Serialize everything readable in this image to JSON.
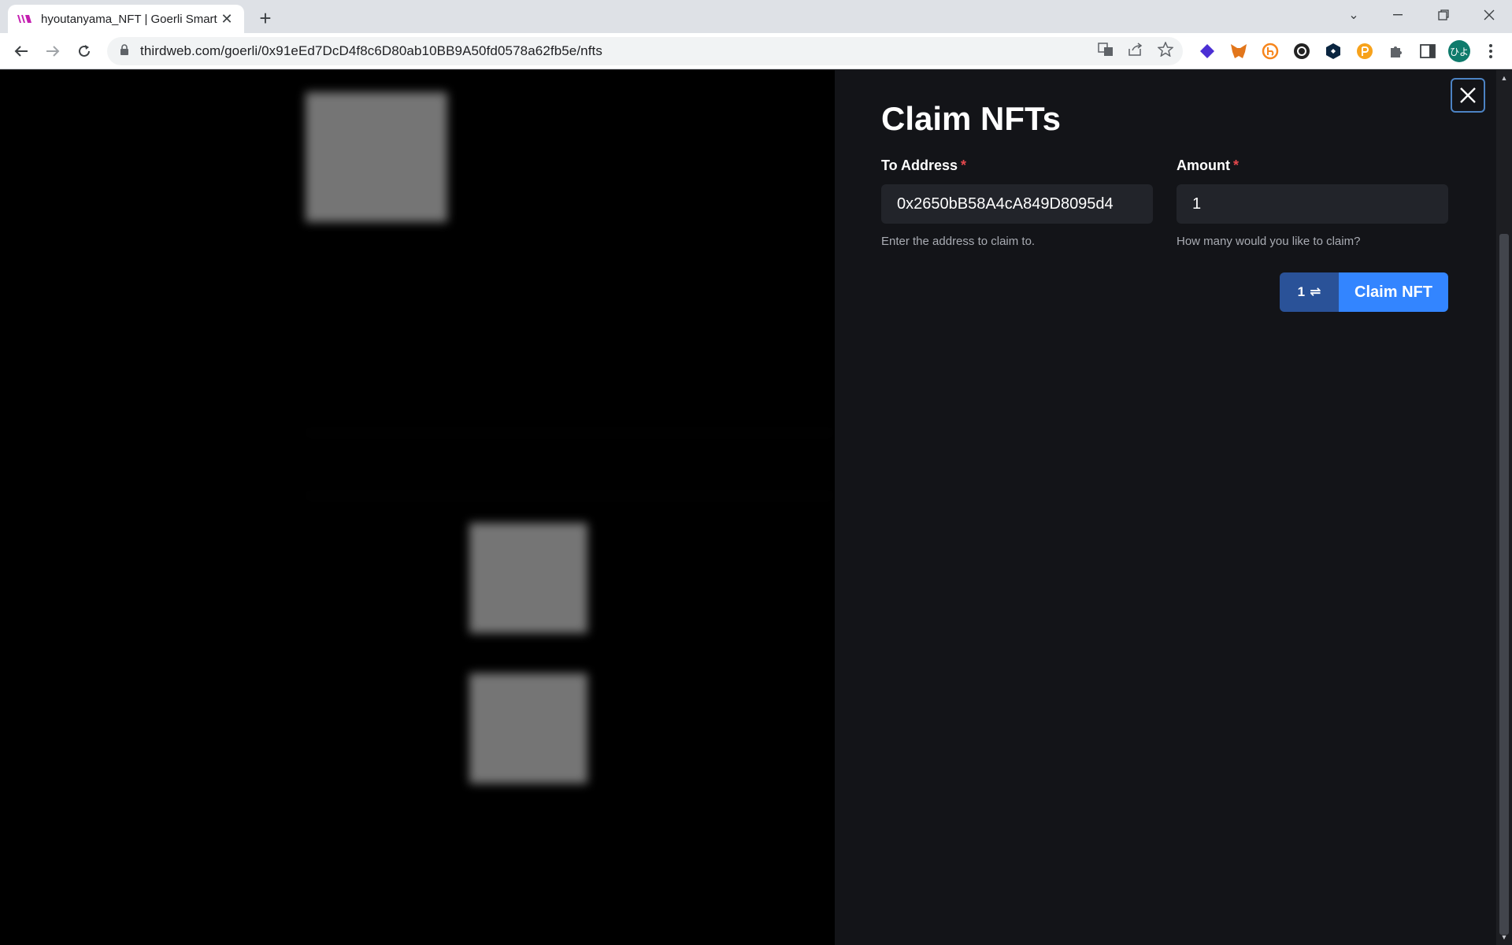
{
  "browser": {
    "tab_title": "hyoutanyama_NFT | Goerli Smart",
    "url": "thirdweb.com/goerli/0x91eEd7DcD4f8c6D80ab10BB9A50fd0578a62fb5e/nfts",
    "avatar_text": "ひよ"
  },
  "drawer": {
    "title": "Claim NFTs",
    "to_address": {
      "label": "To Address",
      "required_mark": "*",
      "value": "0x2650bB58A4cA849D8095d4",
      "help": "Enter the address to claim to."
    },
    "amount": {
      "label": "Amount",
      "required_mark": "*",
      "value": "1",
      "help": "How many would you like to claim?"
    },
    "claim_count": "1",
    "claim_button": "Claim NFT"
  },
  "colors": {
    "accent": "#3385ff",
    "accent_dark": "#2a5298",
    "required": "#e5484d",
    "drawer_bg": "#131418"
  }
}
